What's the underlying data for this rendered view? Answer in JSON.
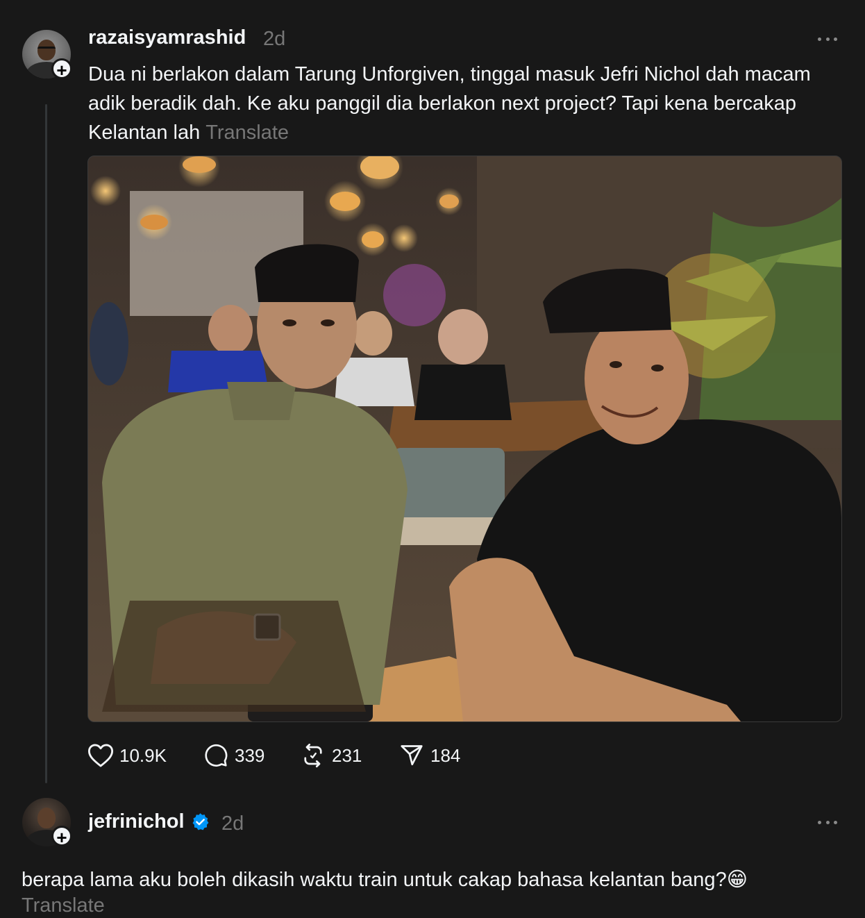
{
  "post": {
    "username": "razaisyamrashid",
    "time": "2d",
    "text": "Dua ni berlakon dalam Tarung Unforgiven, tinggal masuk Jefri Nichol dah macam adik beradik dah. Ke aku panggil dia berlakon next project? Tapi kena bercakap Kelantan lah",
    "translate_label": "Translate",
    "follow_glyph": "+",
    "actions": {
      "likes": "10.9K",
      "comments": "339",
      "reposts": "231",
      "shares": "184"
    }
  },
  "reply": {
    "username": "jefrinichol",
    "time": "2d",
    "text": "berapa lama aku boleh dikasih waktu train untuk cakap bahasa kelantan bang?😁",
    "translate_label": "Translate",
    "follow_glyph": "+"
  },
  "icons": {
    "like": "heart-icon",
    "comment": "comment-bubble-icon",
    "repost": "repost-icon",
    "share": "send-icon",
    "more": "more-dots-icon",
    "verified": "verified-badge-icon"
  },
  "colors": {
    "background": "#181818",
    "text": "#f3f5f7",
    "muted": "#777777",
    "verified": "#0095f6"
  }
}
